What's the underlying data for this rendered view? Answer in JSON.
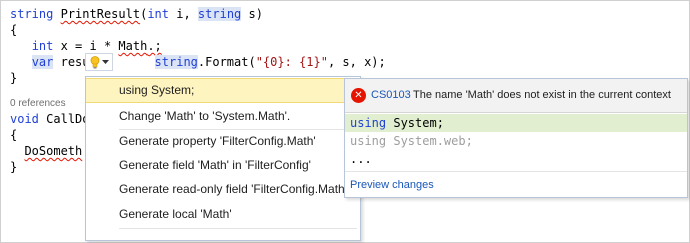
{
  "code": {
    "line1": {
      "kw": "string",
      "name": "PrintResult",
      "paren_kw": "int",
      "param": "i,",
      "kw2": "string",
      "rest": "s)"
    },
    "line2": "{",
    "line3": {
      "kw": "int",
      "rest1": "x = i * ",
      "err": "Math",
      "rest2": ".;"
    },
    "line4": {
      "kw": "var",
      "partial": "resu",
      "kw2": "string",
      "rest1": ".Format(",
      "str": "\"{0}: {1}\"",
      "rest2": ", s, x);"
    },
    "line5": "}",
    "refs": "0 references",
    "line6": {
      "kw": "void",
      "rest": "CallDo"
    },
    "line7": "{",
    "line8": {
      "err": "DoSometh"
    },
    "line9": "}"
  },
  "lightbulb": {
    "icon": "lightbulb-icon",
    "dropdown_icon": "chevron-down-icon"
  },
  "menu": {
    "items": [
      "using System;",
      "Change 'Math' to 'System.Math'.",
      "Generate property 'FilterConfig.Math'",
      "Generate field 'Math' in 'FilterConfig'",
      "Generate read-only field 'FilterConfig.Math'",
      "Generate local 'Math'"
    ]
  },
  "preview": {
    "error_code": "CS0103",
    "error_message": "The name 'Math' does not exist in the current context",
    "lines": [
      {
        "kw": "using",
        "text": "System;"
      },
      {
        "kw": "using",
        "text": "System.web;"
      },
      {
        "text": "..."
      }
    ],
    "link": "Preview changes"
  },
  "colors": {
    "keyword": "#1f3fd6",
    "string": "#a31515",
    "error": "#e51400",
    "selected": "#fdf4bf",
    "added": "#e1efd0",
    "link": "#1a56b8"
  }
}
